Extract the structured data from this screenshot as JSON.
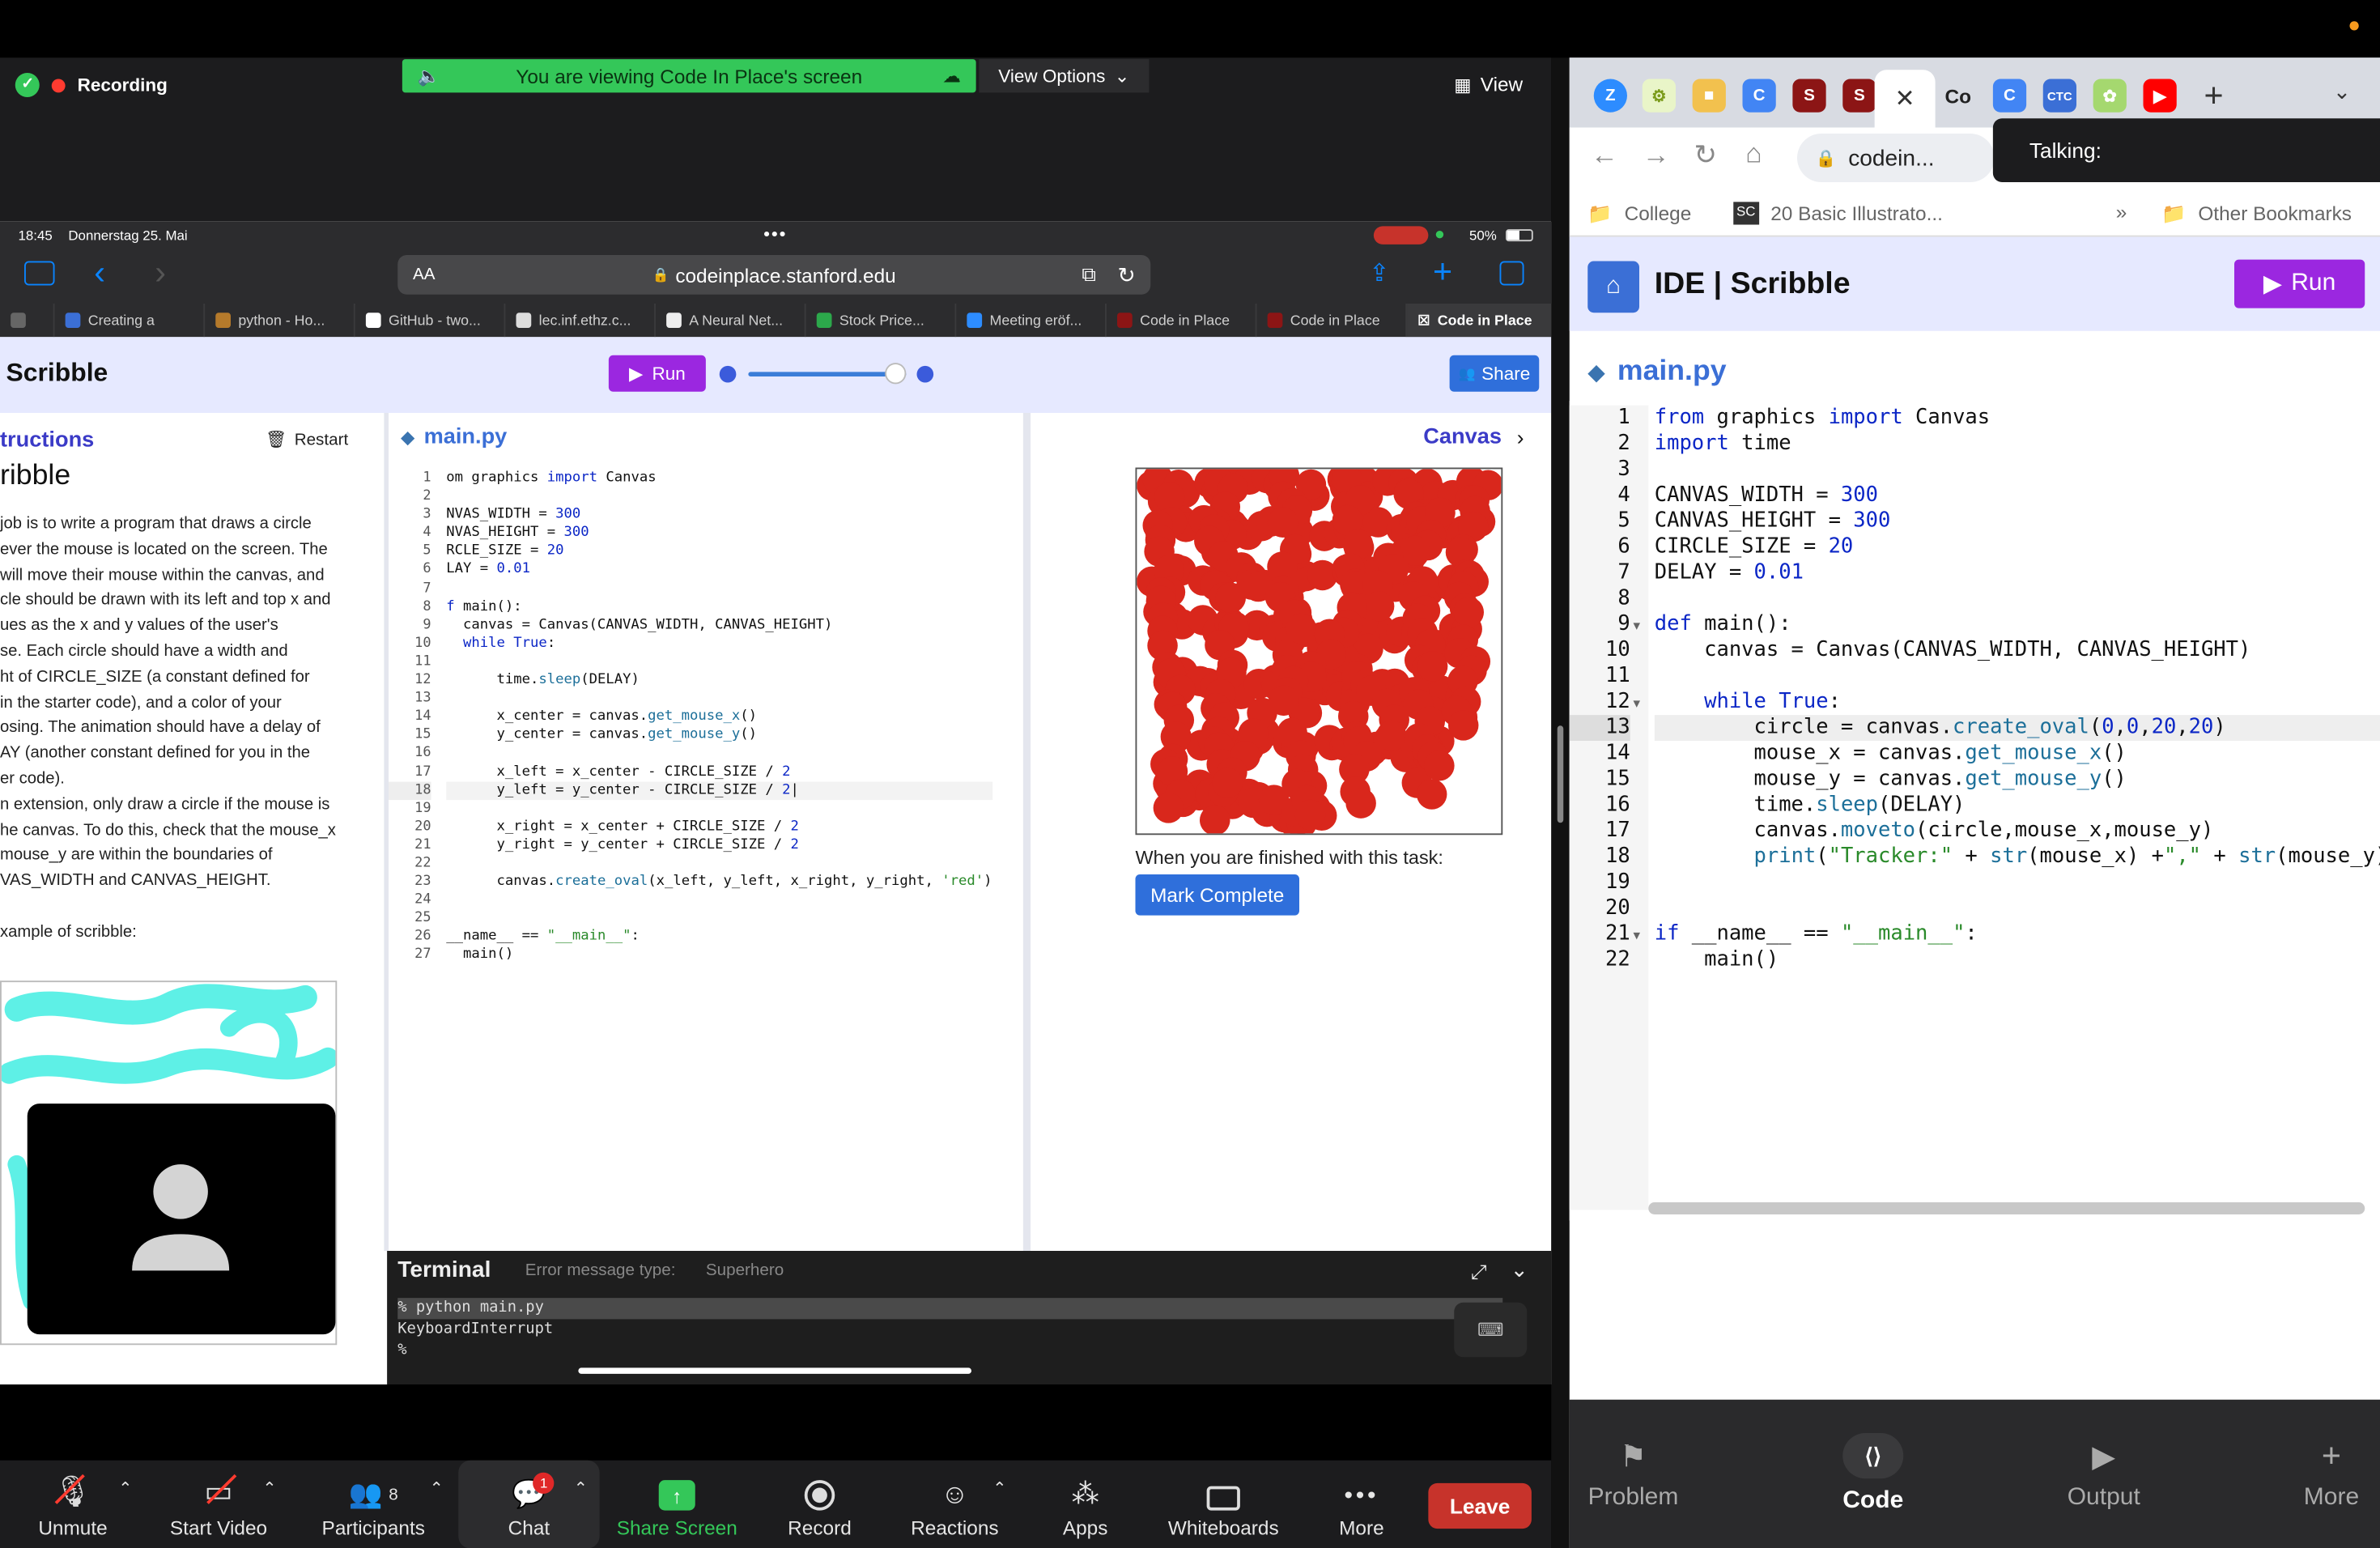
{
  "zoom": {
    "recording_label": "Recording",
    "share_banner": "You are viewing Code In Place's screen",
    "view_options": "View Options",
    "view": "View",
    "toolbar": {
      "unmute": "Unmute",
      "start_video": "Start Video",
      "participants": "Participants",
      "participants_count": "8",
      "chat": "Chat",
      "chat_badge": "1",
      "share_screen": "Share Screen",
      "record": "Record",
      "reactions": "Reactions",
      "apps": "Apps",
      "whiteboards": "Whiteboards",
      "more": "More",
      "leave": "Leave"
    }
  },
  "ipad": {
    "time": "18:45",
    "date": "Donnerstag 25. Mai",
    "battery": "50%",
    "url": "codeinplace.stanford.edu",
    "aa": "AA",
    "tabs": [
      "Creating a",
      "python - Ho...",
      "GitHub - two...",
      "lec.inf.ethz.c...",
      "A Neural Net...",
      "Stock Price...",
      "Meeting eröf...",
      "Code in Place",
      "Code in Place",
      "Code in Place"
    ],
    "ide": {
      "title": "Scribble",
      "run": "Run",
      "share": "Share",
      "instructions_heading": "tructions",
      "restart": "Restart",
      "scribble_heading": "ribble",
      "instructions_text": [
        "job is to write a program that draws a circle",
        "ever the mouse is located on the screen. The",
        " will move their mouse within the canvas, and",
        "cle should be drawn with its left and top x and",
        "ues as the x and y values of the user's",
        "se. Each circle should have a width and",
        "ht of CIRCLE_SIZE (a constant defined for",
        "in the starter code), and a color of your",
        "osing. The animation should have a delay of",
        "AY (another constant defined for you in the",
        "er code).",
        "n extension, only draw a circle if the mouse is",
        "he canvas. To do this, check that the mouse_x",
        "mouse_y are within the boundaries of",
        "VAS_WIDTH and CANVAS_HEIGHT.",
        "",
        "xample of scribble:"
      ],
      "file_name": "main.py",
      "canvas_label": "Canvas",
      "finished_text": "When you are finished with this task:",
      "mark_complete": "Mark Complete",
      "terminal_title": "Terminal",
      "error_type_label": "Error message type:",
      "error_type_value": "Superhero",
      "terminal_lines": [
        "% python main.py",
        "KeyboardInterrupt",
        "%"
      ]
    }
  },
  "right": {
    "url": "codein...",
    "talking": "Talking:",
    "bookmarks": [
      "College",
      "20 Basic Illustrato...",
      "Other Bookmarks"
    ],
    "title": "IDE | Scribble",
    "run": "Run",
    "file_name": "main.py",
    "nav": [
      "Problem",
      "Code",
      "Output",
      "More"
    ]
  },
  "colors": {
    "run_purple": "#9b27e0",
    "header_lavender": "#e6e9ff",
    "canvas_red": "#d9271c",
    "share_green": "#34c759",
    "leave_red": "#c7332b"
  }
}
